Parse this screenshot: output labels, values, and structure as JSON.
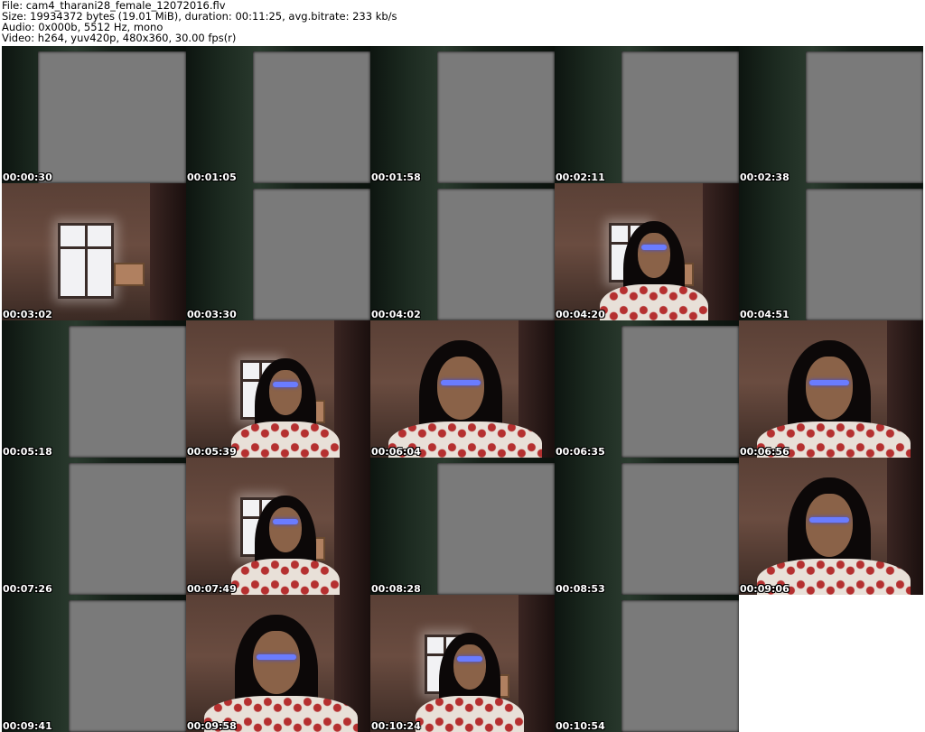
{
  "header": {
    "file_line": "File: cam4_tharani28_female_12072016.flv",
    "size_line": "Size: 19934372 bytes (19.01 MiB), duration: 00:11:25, avg.bitrate: 233 kb/s",
    "audio_line": "Audio: 0x000b, 5512 Hz, mono",
    "video_line": "Video: h264, yuv420p, 480x360, 30.00 fps(r)"
  },
  "thumbnails": [
    {
      "timestamp": "00:00:30",
      "kind": "blank"
    },
    {
      "timestamp": "00:01:05",
      "kind": "blank"
    },
    {
      "timestamp": "00:01:58",
      "kind": "blank"
    },
    {
      "timestamp": "00:02:11",
      "kind": "blank"
    },
    {
      "timestamp": "00:02:38",
      "kind": "blank"
    },
    {
      "timestamp": "00:03:02",
      "kind": "room"
    },
    {
      "timestamp": "00:03:30",
      "kind": "blank"
    },
    {
      "timestamp": "00:04:02",
      "kind": "blank"
    },
    {
      "timestamp": "00:04:20",
      "kind": "person-window"
    },
    {
      "timestamp": "00:04:51",
      "kind": "blank"
    },
    {
      "timestamp": "00:05:18",
      "kind": "blank"
    },
    {
      "timestamp": "00:05:39",
      "kind": "person-window"
    },
    {
      "timestamp": "00:06:04",
      "kind": "person-close"
    },
    {
      "timestamp": "00:06:35",
      "kind": "blank"
    },
    {
      "timestamp": "00:06:56",
      "kind": "person-close"
    },
    {
      "timestamp": "00:07:26",
      "kind": "blank"
    },
    {
      "timestamp": "00:07:49",
      "kind": "person-window"
    },
    {
      "timestamp": "00:08:28",
      "kind": "blank"
    },
    {
      "timestamp": "00:08:53",
      "kind": "blank"
    },
    {
      "timestamp": "00:09:06",
      "kind": "person-close"
    },
    {
      "timestamp": "00:09:41",
      "kind": "blank"
    },
    {
      "timestamp": "00:09:58",
      "kind": "person-close"
    },
    {
      "timestamp": "00:10:24",
      "kind": "person-window"
    },
    {
      "timestamp": "00:10:54",
      "kind": "blank"
    }
  ]
}
